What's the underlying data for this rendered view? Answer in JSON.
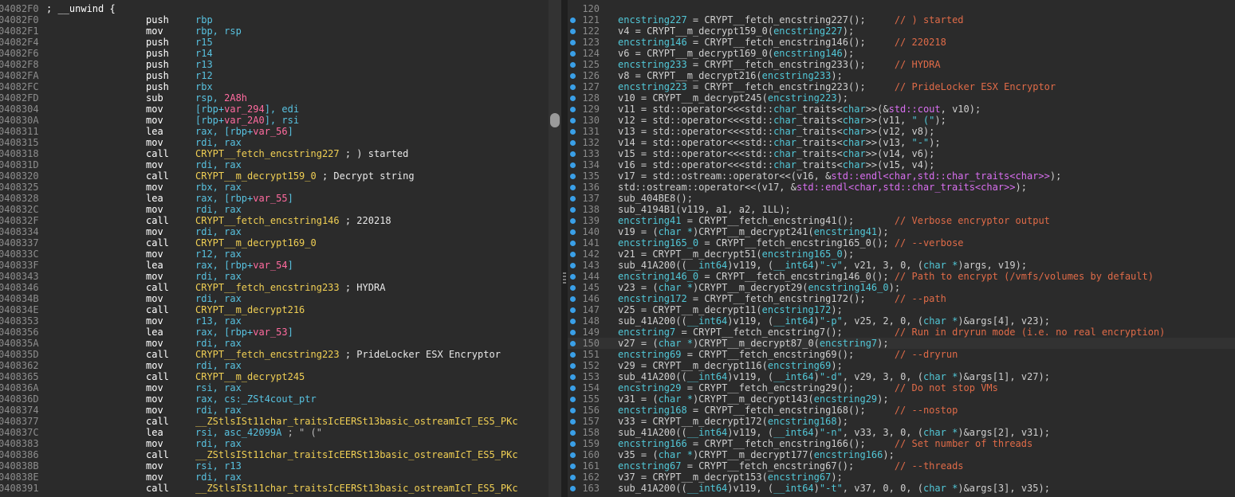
{
  "disasm": {
    "lines": [
      {
        "addr": "04082F0",
        "mnem": "; __unwind {",
        "ops": "",
        "cmt": ""
      },
      {
        "addr": "04082F0",
        "mnem": "push",
        "ops": "rbp",
        "cmt": ""
      },
      {
        "addr": "04082F1",
        "mnem": "mov",
        "ops": "rbp, rsp",
        "cmt": ""
      },
      {
        "addr": "04082F4",
        "mnem": "push",
        "ops": "r15",
        "cmt": ""
      },
      {
        "addr": "04082F6",
        "mnem": "push",
        "ops": "r14",
        "cmt": ""
      },
      {
        "addr": "04082F8",
        "mnem": "push",
        "ops": "r13",
        "cmt": ""
      },
      {
        "addr": "04082FA",
        "mnem": "push",
        "ops": "r12",
        "cmt": ""
      },
      {
        "addr": "04082FC",
        "mnem": "push",
        "ops": "rbx",
        "cmt": ""
      },
      {
        "addr": "04082FD",
        "mnem": "sub",
        "ops": "rsp, 2A8h",
        "cmt": ""
      },
      {
        "addr": "0408304",
        "mnem": "mov",
        "ops": "[rbp+var_294], edi",
        "cmt": ""
      },
      {
        "addr": "040830A",
        "mnem": "mov",
        "ops": "[rbp+var_2A0], rsi",
        "cmt": ""
      },
      {
        "addr": "0408311",
        "mnem": "lea",
        "ops": "rax, [rbp+var_56]",
        "cmt": ""
      },
      {
        "addr": "0408315",
        "mnem": "mov",
        "ops": "rdi, rax",
        "cmt": ""
      },
      {
        "addr": "0408318",
        "mnem": "call",
        "ops": "CRYPT__fetch_encstring227",
        "cmt": "; ) started"
      },
      {
        "addr": "040831D",
        "mnem": "mov",
        "ops": "rdi, rax",
        "cmt": ""
      },
      {
        "addr": "0408320",
        "mnem": "call",
        "ops": "CRYPT__m_decrypt159_0",
        "cmt": "; Decrypt string"
      },
      {
        "addr": "0408325",
        "mnem": "mov",
        "ops": "rbx, rax",
        "cmt": ""
      },
      {
        "addr": "0408328",
        "mnem": "lea",
        "ops": "rax, [rbp+var_55]",
        "cmt": ""
      },
      {
        "addr": "040832C",
        "mnem": "mov",
        "ops": "rdi, rax",
        "cmt": ""
      },
      {
        "addr": "040832F",
        "mnem": "call",
        "ops": "CRYPT__fetch_encstring146",
        "cmt": "; 220218"
      },
      {
        "addr": "0408334",
        "mnem": "mov",
        "ops": "rdi, rax",
        "cmt": ""
      },
      {
        "addr": "0408337",
        "mnem": "call",
        "ops": "CRYPT__m_decrypt169_0",
        "cmt": ""
      },
      {
        "addr": "040833C",
        "mnem": "mov",
        "ops": "r12, rax",
        "cmt": ""
      },
      {
        "addr": "040833F",
        "mnem": "lea",
        "ops": "rax, [rbp+var_54]",
        "cmt": ""
      },
      {
        "addr": "0408343",
        "mnem": "mov",
        "ops": "rdi, rax",
        "cmt": ""
      },
      {
        "addr": "0408346",
        "mnem": "call",
        "ops": "CRYPT__fetch_encstring233",
        "cmt": "; HYDRA"
      },
      {
        "addr": "040834B",
        "mnem": "mov",
        "ops": "rdi, rax",
        "cmt": ""
      },
      {
        "addr": "040834E",
        "mnem": "call",
        "ops": "CRYPT__m_decrypt216",
        "cmt": ""
      },
      {
        "addr": "0408353",
        "mnem": "mov",
        "ops": "r13, rax",
        "cmt": ""
      },
      {
        "addr": "0408356",
        "mnem": "lea",
        "ops": "rax, [rbp+var_53]",
        "cmt": ""
      },
      {
        "addr": "040835A",
        "mnem": "mov",
        "ops": "rdi, rax",
        "cmt": ""
      },
      {
        "addr": "040835D",
        "mnem": "call",
        "ops": "CRYPT__fetch_encstring223",
        "cmt": "; PrideLocker ESX Encryptor"
      },
      {
        "addr": "0408362",
        "mnem": "mov",
        "ops": "rdi, rax",
        "cmt": ""
      },
      {
        "addr": "0408365",
        "mnem": "call",
        "ops": "CRYPT__m_decrypt245",
        "cmt": ""
      },
      {
        "addr": "040836A",
        "mnem": "mov",
        "ops": "rsi, rax",
        "cmt": ""
      },
      {
        "addr": "040836D",
        "mnem": "mov",
        "ops": "rax, cs:_ZSt4cout_ptr",
        "cmt": ""
      },
      {
        "addr": "0408374",
        "mnem": "mov",
        "ops": "rdi, rax",
        "cmt": ""
      },
      {
        "addr": "0408377",
        "mnem": "call",
        "ops": "__ZStlsISt11char_traitsIcEERSt13basic_ostreamIcT_ES5_PKc",
        "cmt": ""
      },
      {
        "addr": "040837C",
        "mnem": "lea",
        "ops": "rsi, asc_42099A",
        "cmt": "; \" (\""
      },
      {
        "addr": "0408383",
        "mnem": "mov",
        "ops": "rdi, rax",
        "cmt": ""
      },
      {
        "addr": "0408386",
        "mnem": "call",
        "ops": "__ZStlsISt11char_traitsIcEERSt13basic_ostreamIcT_ES5_PKc",
        "cmt": ""
      },
      {
        "addr": "040838B",
        "mnem": "mov",
        "ops": "rsi, r13",
        "cmt": ""
      },
      {
        "addr": "040838E",
        "mnem": "mov",
        "ops": "rdi, rax",
        "cmt": ""
      },
      {
        "addr": "0408391",
        "mnem": "call",
        "ops": "__ZStlsISt11char_traitsIcEERSt13basic_ostreamIcT_ES5_PKc",
        "cmt": ""
      }
    ]
  },
  "pseudocode": {
    "lines": [
      {
        "n": "120",
        "code": ""
      },
      {
        "n": "121",
        "code": "encstring227 = CRYPT__fetch_encstring227();",
        "cmt": "// ) started"
      },
      {
        "n": "122",
        "code": "v4 = CRYPT__m_decrypt159_0(encstring227);"
      },
      {
        "n": "123",
        "code": "encstring146 = CRYPT__fetch_encstring146();",
        "cmt": "// 220218"
      },
      {
        "n": "124",
        "code": "v6 = CRYPT__m_decrypt169_0(encstring146);"
      },
      {
        "n": "125",
        "code": "encstring233 = CRYPT__fetch_encstring233();",
        "cmt": "// HYDRA"
      },
      {
        "n": "126",
        "code": "v8 = CRYPT__m_decrypt216(encstring233);"
      },
      {
        "n": "127",
        "code": "encstring223 = CRYPT__fetch_encstring223();",
        "cmt": "// PrideLocker ESX Encryptor"
      },
      {
        "n": "128",
        "code": "v10 = CRYPT__m_decrypt245(encstring223);"
      },
      {
        "n": "129",
        "code": "v11 = std::operator<<<std::char_traits<char>>(&std::cout, v10);"
      },
      {
        "n": "130",
        "code": "v12 = std::operator<<<std::char_traits<char>>(v11, \" (\");"
      },
      {
        "n": "131",
        "code": "v13 = std::operator<<<std::char_traits<char>>(v12, v8);"
      },
      {
        "n": "132",
        "code": "v14 = std::operator<<<std::char_traits<char>>(v13, \"-\");"
      },
      {
        "n": "133",
        "code": "v15 = std::operator<<<std::char_traits<char>>(v14, v6);"
      },
      {
        "n": "134",
        "code": "v16 = std::operator<<<std::char_traits<char>>(v15, v4);"
      },
      {
        "n": "135",
        "code": "v17 = std::ostream::operator<<(v16, &std::endl<char,std::char_traits<char>>);"
      },
      {
        "n": "136",
        "code": "std::ostream::operator<<(v17, &std::endl<char,std::char_traits<char>>);"
      },
      {
        "n": "137",
        "code": "sub_404BE8();"
      },
      {
        "n": "138",
        "code": "sub_4194B1(v119, a1, a2, 1LL);"
      },
      {
        "n": "139",
        "code": "encstring41 = CRYPT__fetch_encstring41();",
        "cmt": "// Verbose encryptor output"
      },
      {
        "n": "140",
        "code": "v19 = (char *)CRYPT__m_decrypt241(encstring41);"
      },
      {
        "n": "141",
        "code": "encstring165_0 = CRYPT__fetch_encstring165_0();",
        "cmt": "// --verbose"
      },
      {
        "n": "142",
        "code": "v21 = CRYPT__m_decrypt51(encstring165_0);"
      },
      {
        "n": "143",
        "code": "sub_41A200((__int64)v119, (__int64)\"-v\", v21, 3, 0, (char *)args, v19);"
      },
      {
        "n": "144",
        "code": "encstring146_0 = CRYPT__fetch_encstring146_0();",
        "cmt": "// Path to encrypt (/vmfs/volumes by default)"
      },
      {
        "n": "145",
        "code": "v23 = (char *)CRYPT__m_decrypt29(encstring146_0);"
      },
      {
        "n": "146",
        "code": "encstring172 = CRYPT__fetch_encstring172();",
        "cmt": "// --path"
      },
      {
        "n": "147",
        "code": "v25 = CRYPT__m_decrypt11(encstring172);"
      },
      {
        "n": "148",
        "code": "sub_41A200((__int64)v119, (__int64)\"-p\", v25, 2, 0, (char *)&args[4], v23);"
      },
      {
        "n": "149",
        "code": "encstring7 = CRYPT__fetch_encstring7();",
        "cmt": "// Run in dryrun mode (i.e. no real encryption)"
      },
      {
        "n": "150",
        "code": "v27 = (char *)CRYPT__m_decrypt87_0(encstring7);"
      },
      {
        "n": "151",
        "code": "encstring69 = CRYPT__fetch_encstring69();",
        "cmt": "// --dryrun"
      },
      {
        "n": "152",
        "code": "v29 = CRYPT__m_decrypt116(encstring69);"
      },
      {
        "n": "153",
        "code": "sub_41A200((__int64)v119, (__int64)\"-d\", v29, 3, 0, (char *)&args[1], v27);"
      },
      {
        "n": "154",
        "code": "encstring29 = CRYPT__fetch_encstring29();",
        "cmt": "// Do not stop VMs"
      },
      {
        "n": "155",
        "code": "v31 = (char *)CRYPT__m_decrypt143(encstring29);"
      },
      {
        "n": "156",
        "code": "encstring168 = CRYPT__fetch_encstring168();",
        "cmt": "// --nostop"
      },
      {
        "n": "157",
        "code": "v33 = CRYPT__m_decrypt172(encstring168);"
      },
      {
        "n": "158",
        "code": "sub_41A200((__int64)v119, (__int64)\"-n\", v33, 3, 0, (char *)&args[2], v31);"
      },
      {
        "n": "159",
        "code": "encstring166 = CRYPT__fetch_encstring166();",
        "cmt": "// Set number of threads"
      },
      {
        "n": "160",
        "code": "v35 = (char *)CRYPT__m_decrypt177(encstring166);"
      },
      {
        "n": "161",
        "code": "encstring67 = CRYPT__fetch_encstring67();",
        "cmt": "// --threads"
      },
      {
        "n": "162",
        "code": "v37 = CRYPT__m_decrypt153(encstring67);"
      },
      {
        "n": "163",
        "code": "sub_41A200((__int64)v119, (__int64)\"-t\", v37, 0, 0, (char *)&args[3], v35);"
      }
    ]
  },
  "colors": {
    "background": "#2b2b2b",
    "address": "#8d8d8d",
    "function": "#f0cf54",
    "operand": "#58c2e0",
    "comment": "#e06b48",
    "breakpoint_dot": "#3aa0e8"
  }
}
